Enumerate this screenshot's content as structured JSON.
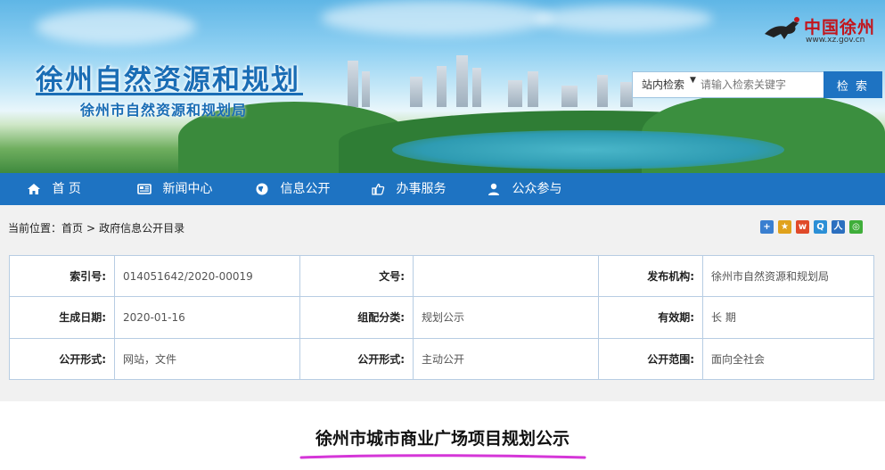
{
  "header": {
    "site_title": "徐州自然资源和规划",
    "site_subtitle": "徐州市自然资源和规划局",
    "logo_text": "中国徐州",
    "logo_url_text": "www.xz.gov.cn",
    "search": {
      "scope": "站内检索",
      "placeholder": "请输入检索关键字",
      "button": "检 索"
    }
  },
  "nav": {
    "items": [
      {
        "label": "首 页",
        "icon": "home-icon"
      },
      {
        "label": "新闻中心",
        "icon": "newspaper-icon"
      },
      {
        "label": "信息公开",
        "icon": "globe-icon"
      },
      {
        "label": "办事服务",
        "icon": "thumbs-up-icon"
      },
      {
        "label": "公众参与",
        "icon": "user-icon"
      }
    ]
  },
  "breadcrumb": {
    "prefix": "当前位置：",
    "home": "首页",
    "separator": ">",
    "current": "政府信息公开目录"
  },
  "share_icons": [
    "add-share-icon",
    "star-share-icon",
    "weibo-share-icon",
    "qzone-share-icon",
    "renren-share-icon",
    "wechat-share-icon"
  ],
  "info_table": {
    "rows": [
      [
        {
          "key": "索引号:",
          "value": "014051642/2020-00019"
        },
        {
          "key": "文号:",
          "value": ""
        },
        {
          "key": "发布机构:",
          "value": "徐州市自然资源和规划局"
        }
      ],
      [
        {
          "key": "生成日期:",
          "value": "2020-01-16"
        },
        {
          "key": "组配分类:",
          "value": "规划公示"
        },
        {
          "key": "有效期:",
          "value": "长 期"
        }
      ],
      [
        {
          "key": "公开形式:",
          "value": "网站，文件"
        },
        {
          "key": "公开形式:",
          "value": "主动公开"
        },
        {
          "key": "公开范围:",
          "value": "面向全社会"
        }
      ]
    ]
  },
  "article": {
    "title": "徐州市城市商业广场项目规划公示"
  },
  "colors": {
    "nav_blue": "#1e73c2",
    "title_blue": "#1a6db5",
    "logo_red": "#c2151c",
    "underline_magenta": "#d536d8",
    "table_border": "#b7cde3"
  }
}
